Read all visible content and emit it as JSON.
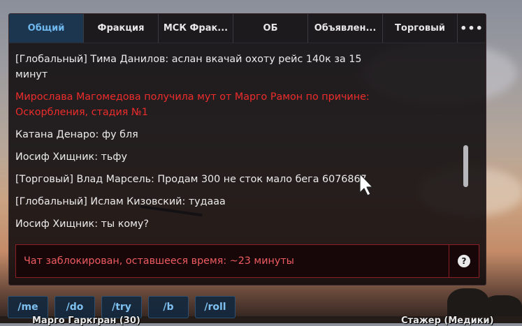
{
  "tabs": [
    {
      "label": "Общий",
      "active": true
    },
    {
      "label": "Фракция",
      "active": false
    },
    {
      "label": "МСК Фрак...",
      "active": false
    },
    {
      "label": "ОБ",
      "active": false
    },
    {
      "label": "Объявлен...",
      "active": false
    },
    {
      "label": "Торговый",
      "active": false
    },
    {
      "label": "•••",
      "active": false
    }
  ],
  "messages": [
    {
      "text": "[Глобальный] Тима Данилов: аслан вкачай охоту рейс 140к за 15 минут",
      "color": "#ececec"
    },
    {
      "text": "Мирослава Магомедова получила мут от Марго Рамон по причине: Оскорбления, стадия №1",
      "color": "#ee2c2c"
    },
    {
      "text": "Катана Денаро: фу бля",
      "color": "#ececec"
    },
    {
      "text": "Иосиф Хищник: тьфу",
      "color": "#ececec"
    },
    {
      "text": "[Торговый] Влад Марсель: Продам 300 не сток мало бега 6076867",
      "color": "#ececec"
    },
    {
      "text": "[Глобальный] Ислам Кизовский: тудааа",
      "color": "#ececec"
    },
    {
      "text": "Иосиф Хищник: ты кому?",
      "color": "#ececec"
    }
  ],
  "input": {
    "status_text": "Чат заблокирован, оставшееся время: ~23 минуты",
    "help_label": "?"
  },
  "commands": [
    "/me",
    "/do",
    "/try",
    "/b",
    "/roll"
  ],
  "nametags": {
    "left": "Марго Гаркгран (30)",
    "right": "Стажер (Медики)"
  },
  "colors": {
    "active_tab_bg": "#1c3650",
    "active_tab_text": "#6fb8ee",
    "system_message": "#ee2c2c",
    "blocked_text": "#ee5b60",
    "blocked_border": "#8a1e22",
    "command_text": "#7ec0f0"
  },
  "icons": {
    "more": "more-horizontal-icon",
    "help": "question-circle-icon",
    "cursor": "mouse-pointer-icon"
  }
}
